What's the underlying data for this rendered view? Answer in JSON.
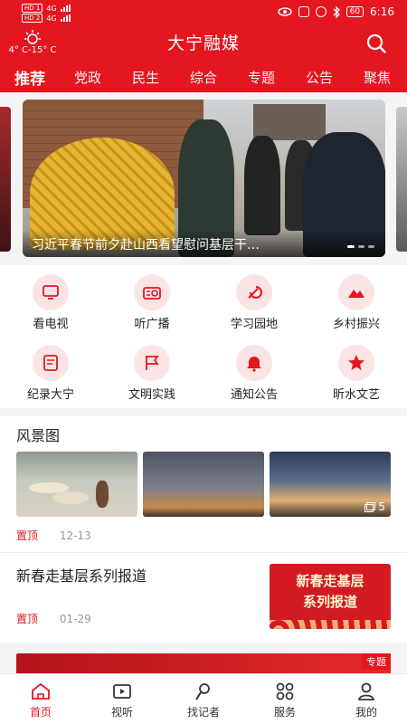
{
  "status_bar": {
    "hd1": "HD 1",
    "hd2": "HD 2",
    "net1": "4G",
    "net2": "4G",
    "battery": "60",
    "time": "6:16"
  },
  "header": {
    "weather": "4° C-15° C",
    "title": "大宁融媒",
    "search_icon": "search-icon"
  },
  "tabs": [
    {
      "label": "推荐",
      "active": true
    },
    {
      "label": "党政"
    },
    {
      "label": "民生"
    },
    {
      "label": "综合"
    },
    {
      "label": "专题"
    },
    {
      "label": "公告"
    },
    {
      "label": "聚焦"
    }
  ],
  "carousel": {
    "caption": "习近平春节前夕赴山西看望慰问基层干…",
    "slide_count": 3,
    "active_index": 0
  },
  "grid": [
    {
      "label": "看电视",
      "icon": "tv-icon"
    },
    {
      "label": "听广播",
      "icon": "radio-icon"
    },
    {
      "label": "学习园地",
      "icon": "party-emblem-icon"
    },
    {
      "label": "乡村振兴",
      "icon": "mountain-icon"
    },
    {
      "label": "纪录大宁",
      "icon": "document-icon"
    },
    {
      "label": "文明实践",
      "icon": "flag-icon"
    },
    {
      "label": "通知公告",
      "icon": "bell-icon"
    },
    {
      "label": "昕水文艺",
      "icon": "star-icon"
    }
  ],
  "scenery": {
    "title": "风景图",
    "pin_label": "置顶",
    "date": "12-13",
    "image_count": "5"
  },
  "article": {
    "title": "新春走基层系列报道",
    "pin_label": "置顶",
    "date": "01-29",
    "thumb_line1": "新春走基层",
    "thumb_line2": "系列报道"
  },
  "banner": {
    "badge": "专题"
  },
  "bottom_nav": [
    {
      "label": "首页",
      "icon": "home-icon",
      "active": true
    },
    {
      "label": "视听",
      "icon": "play-icon"
    },
    {
      "label": "找记者",
      "icon": "reporter-icon"
    },
    {
      "label": "服务",
      "icon": "grid-services-icon"
    },
    {
      "label": "我的",
      "icon": "user-icon"
    }
  ],
  "colors": {
    "brand": "#e41620",
    "icon_bg": "#fbe5e4"
  }
}
